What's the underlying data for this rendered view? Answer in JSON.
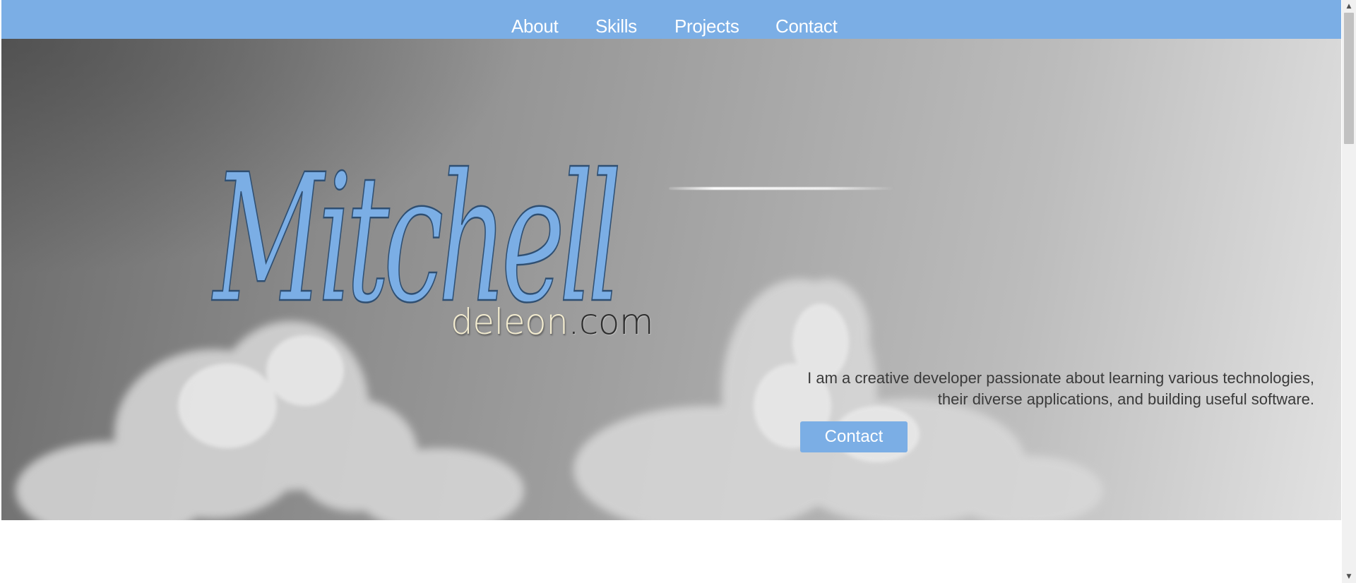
{
  "nav": {
    "items": [
      {
        "label": "About"
      },
      {
        "label": "Skills"
      },
      {
        "label": "Projects"
      },
      {
        "label": "Contact"
      }
    ]
  },
  "hero": {
    "logo_script": "Mitchell",
    "logo_domain_name": "deleon",
    "logo_domain_tld": ".com",
    "tagline_line1": "I am a creative developer passionate about learning various technologies,",
    "tagline_line2": "their diverse applications, and building useful software.",
    "cta_label": "Contact"
  },
  "colors": {
    "accent": "#7baee5",
    "script_fill": "#7baee5",
    "domain_light": "#f2ebcf",
    "domain_dark": "#2d2d2d"
  },
  "icons": {
    "scroll_up": "scroll-up-arrow-icon",
    "scroll_down": "scroll-down-arrow-icon"
  }
}
